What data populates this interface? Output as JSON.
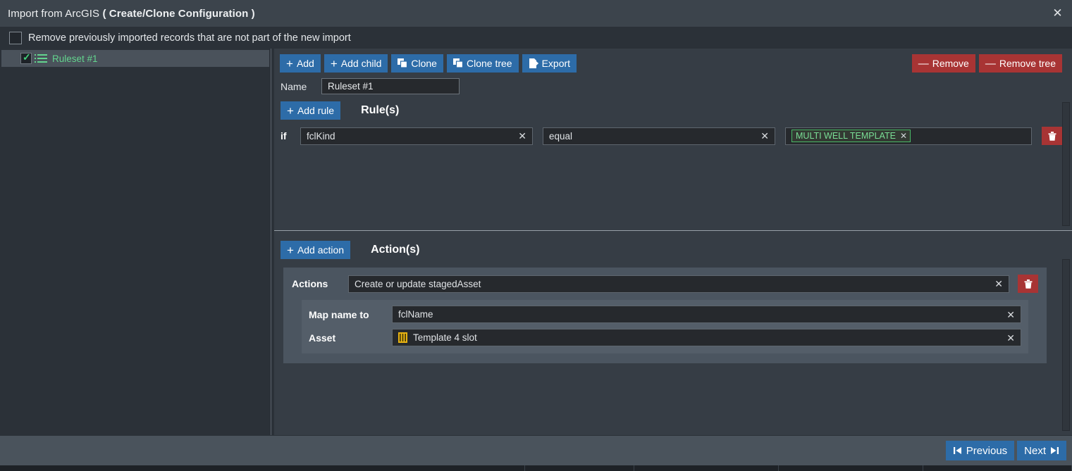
{
  "window": {
    "title_main": "Import from ArcGIS ",
    "title_bold": "( Create/Clone Configuration )",
    "close_label": "✕"
  },
  "options": {
    "remove_previous_label": "Remove previously imported records that are not part of the new import",
    "remove_previous_checked": false
  },
  "sidebar": {
    "items": [
      {
        "label": "Ruleset #1",
        "checked": true,
        "icon": "list-icon"
      }
    ]
  },
  "toolbar": {
    "add_label": "Add",
    "add_child_label": "Add child",
    "clone_label": "Clone",
    "clone_tree_label": "Clone tree",
    "export_label": "Export",
    "remove_label": "Remove",
    "remove_tree_label": "Remove tree"
  },
  "name_row": {
    "label": "Name",
    "value": "Ruleset #1"
  },
  "rules": {
    "add_rule_label": "Add rule",
    "section_title": "Rule(s)",
    "rows": [
      {
        "prefix": "if",
        "field": "fclKind",
        "operator": "equal",
        "value_chip": "MULTI WELL TEMPLATE",
        "clear_icon": "✕",
        "delete_icon": "trash-icon"
      }
    ]
  },
  "actions": {
    "add_action_label": "Add action",
    "section_title": "Action(s)",
    "card": {
      "label": "Actions",
      "value": "Create or update stagedAsset",
      "clear_icon": "✕",
      "delete_icon": "trash-icon",
      "rows": [
        {
          "label": "Map name to",
          "value": "fclName",
          "clear_icon": "✕",
          "has_icon": false
        },
        {
          "label": "Asset",
          "value": "Template 4 slot",
          "clear_icon": "✕",
          "has_icon": true,
          "icon": "well-template-icon"
        }
      ]
    }
  },
  "footer": {
    "previous_label": "Previous",
    "next_label": "Next"
  },
  "colors": {
    "accent_blue": "#2d6ca8",
    "danger_red": "#a83434",
    "green_text": "#63d48e",
    "panel_bg": "#363d45",
    "window_bg": "#2b3138",
    "card_bg": "#4b5560"
  }
}
